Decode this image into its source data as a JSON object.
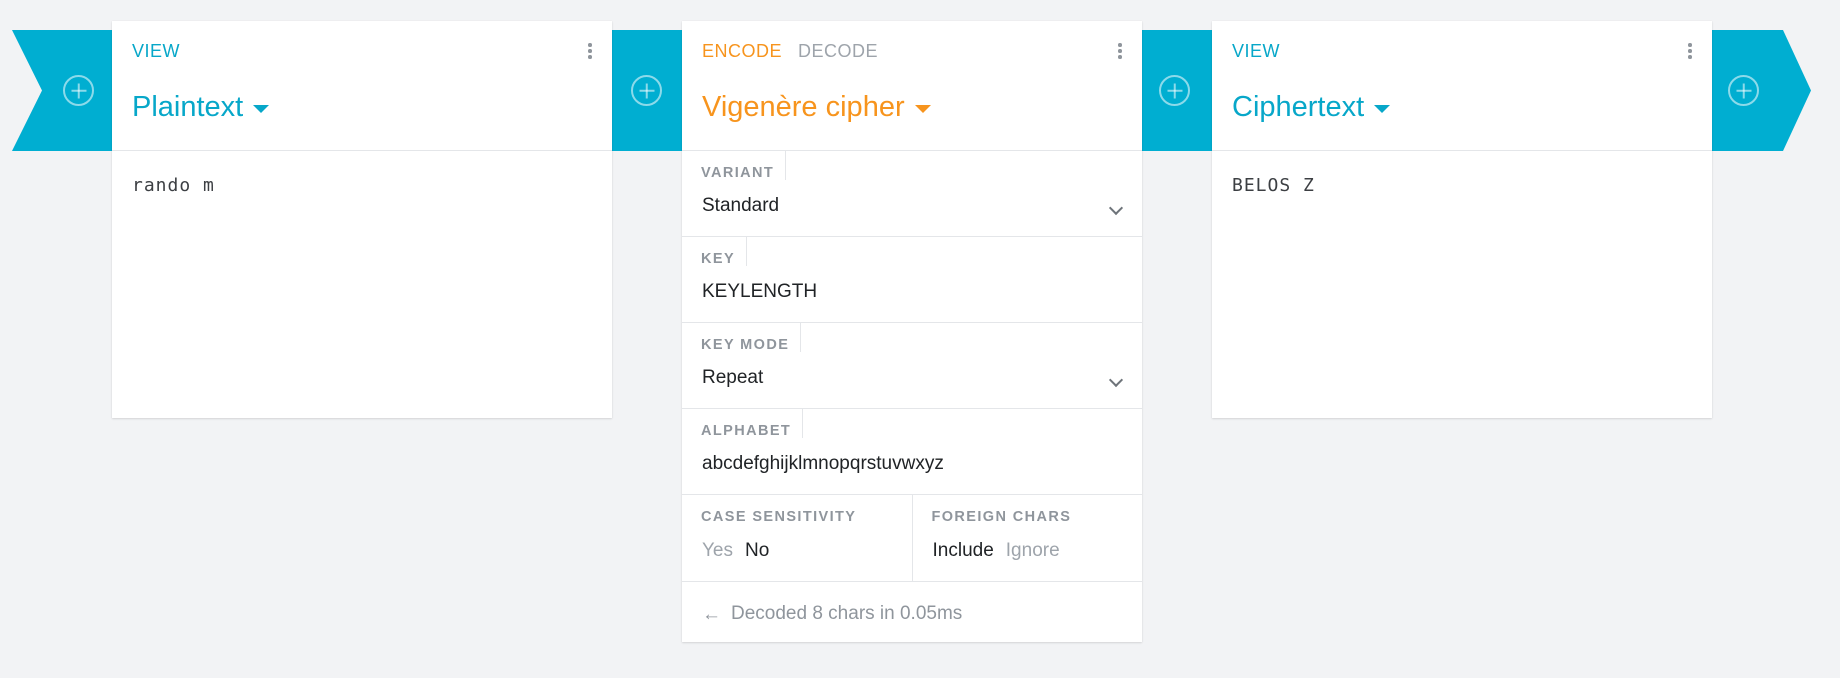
{
  "pipeline": {
    "add_label": "add"
  },
  "plaintext_card": {
    "tab": "VIEW",
    "title": "Plaintext",
    "content": "rando m"
  },
  "cipher_card": {
    "tabs": [
      "ENCODE",
      "DECODE"
    ],
    "title": "Vigenère cipher",
    "fields": [
      {
        "label": "VARIANT",
        "value": "Standard",
        "type": "select"
      },
      {
        "label": "KEY",
        "value": "KEYLENGTH",
        "type": "text"
      },
      {
        "label": "KEY MODE",
        "value": "Repeat",
        "type": "select"
      },
      {
        "label": "ALPHABET",
        "value": "abcdefghijklmnopqrstuvwxyz",
        "type": "text"
      }
    ],
    "case_sensitivity": {
      "label": "CASE SENSITIVITY",
      "options": [
        "Yes",
        "No"
      ],
      "selected": "No"
    },
    "foreign_chars": {
      "label": "FOREIGN CHARS",
      "options": [
        "Include",
        "Ignore"
      ],
      "selected": "Include"
    },
    "status_arrow": "←",
    "status": "Decoded 8 chars in 0.05ms"
  },
  "ciphertext_card": {
    "tab": "VIEW",
    "title": "Ciphertext",
    "content": "BELOS Z"
  },
  "colors": {
    "brand_blue": "#00aed1",
    "accent_blue": "#07a7c9",
    "accent_orange": "#f7941d"
  }
}
